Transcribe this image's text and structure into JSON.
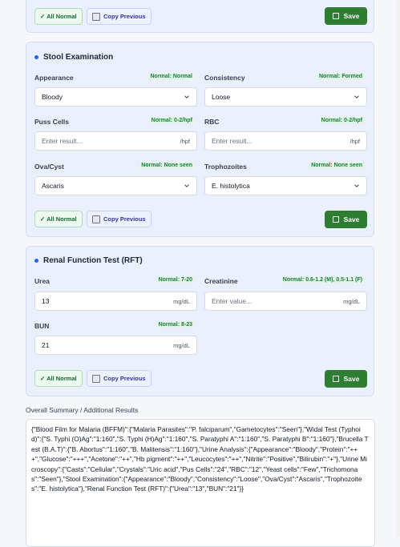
{
  "buttons": {
    "all_normal": "✓ All Normal",
    "copy_previous": "Copy Previous",
    "save": "Save"
  },
  "stool": {
    "title": "Stool Examination",
    "appearance": {
      "label": "Appearance",
      "normal": "Normal: Normal",
      "value": "Bloody"
    },
    "consistency": {
      "label": "Consistency",
      "normal": "Normal: Formed",
      "value": "Loose"
    },
    "puss_cells": {
      "label": "Puss Cells",
      "normal": "Normal: 0-2/hpf",
      "placeholder": "Enter result...",
      "unit": "/hpf"
    },
    "rbc": {
      "label": "RBC",
      "normal": "Normal: 0-2/hpf",
      "placeholder": "Enter result...",
      "unit": "/hpf"
    },
    "ova_cyst": {
      "label": "Ova/Cyst",
      "normal": "Normal: None seen",
      "value": "Ascaris"
    },
    "trophozoites": {
      "label": "Trophozoites",
      "normal": "Normal: None seen",
      "value": "E. histolytica"
    }
  },
  "rft": {
    "title": "Renal Function Test (RFT)",
    "urea": {
      "label": "Urea",
      "normal": "Normal: 7-20",
      "value": "13",
      "unit": "mg/dL"
    },
    "creatinine": {
      "label": "Creatinine",
      "normal": "Normal: 0.6-1.2 (M), 0.5-1.1 (F)",
      "placeholder": "Enter value...",
      "unit": "mg/dL"
    },
    "bun": {
      "label": "BUN",
      "normal": "Normal: 8-23",
      "value": "21",
      "unit": "mg/dL"
    }
  },
  "summary": {
    "label": "Overall Summary / Additional Results",
    "text": "{\"Blood Film for Malaria (BFFM)\":{\"Malaria Parasites\":\"P. falciparum\",\"Gametocytes\":\"Seen\"},\"Widal Test (Typhoid)\":{\"S. Typhi (O)Ag\":\"1:160\",\"S. Typhi (H)Ag\":\"1:160\",\"S. Paratyphi A\":\"1:160\",\"S. Paratyphi B\":\"1:160\"},\"Brucella Test (B.A.T)\":{\"B. Abortus\":\"1:160\",\"B. Malitensis\":\"1:160\"},\"Urine Analysis\":{\"Appearance\":\"Bloody\",\"Protein\":\"+++\",\"Glucose\":\"+++\",\"Acetone\":\"++\",\"Hb pigment\":\"++\",\"Leucocytes\":\"++\",\"Nitrite\":\"Positive\",\"Bilirubin\":\"+\"},\"Urine Microscopy\":{\"Casts\":\"Cellular\",\"Crystals\":\"Uric acid\",\"Pus Cells\":\"24\",\"RBC\":\"12\",\"Yeast cells\":\"Few\",\"Trichomonas\":\"Seen\"},\"Stool Examination\":{\"Appearance\":\"Bloody\",\"Consistency\":\"Loose\",\"Ova/Cyst\":\"Ascaris\",\"Trophozoites\":\"E. histolytica\"},\"Renal Function Test (RFT)\":{\"Urea\":\"13\",\"BUN\":\"21\"}}"
  },
  "colors": {
    "accent": "#2563eb",
    "save": "#2e7d32",
    "normal_text": "#15803d",
    "panel_bg": "#eaf0fd"
  }
}
